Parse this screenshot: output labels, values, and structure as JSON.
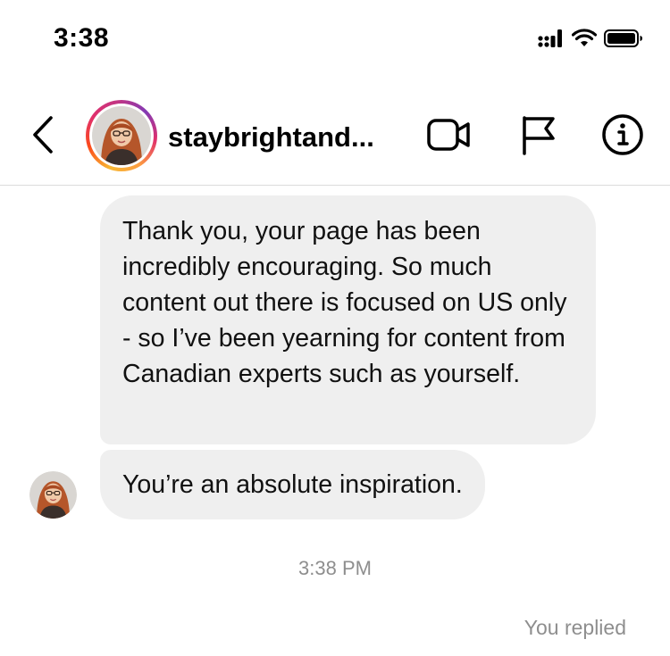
{
  "status_bar": {
    "time": "3:38",
    "icons": [
      "signal-icon",
      "wifi-icon",
      "battery-icon"
    ]
  },
  "header": {
    "username": "staybrightand...",
    "actions": [
      "video-call-icon",
      "flag-icon",
      "info-icon"
    ]
  },
  "messages": [
    {
      "text": "Thank you, your page has been incredibly encouraging. So much content out there is focused on US only - so I’ve been yearning for content from Canadian experts such as yourself.",
      "sender": "other"
    },
    {
      "text": "You’re an absolute inspiration.",
      "sender": "other"
    }
  ],
  "timestamp": "3:38 PM",
  "reply_status": "You replied",
  "colors": {
    "bubble": "#efefef",
    "muted_text": "#8e8e8e",
    "divider": "#dbdbdb",
    "story_ring": [
      "#f7b733",
      "#fc4a1a",
      "#e1306c",
      "#c13584",
      "#833ab4"
    ]
  }
}
